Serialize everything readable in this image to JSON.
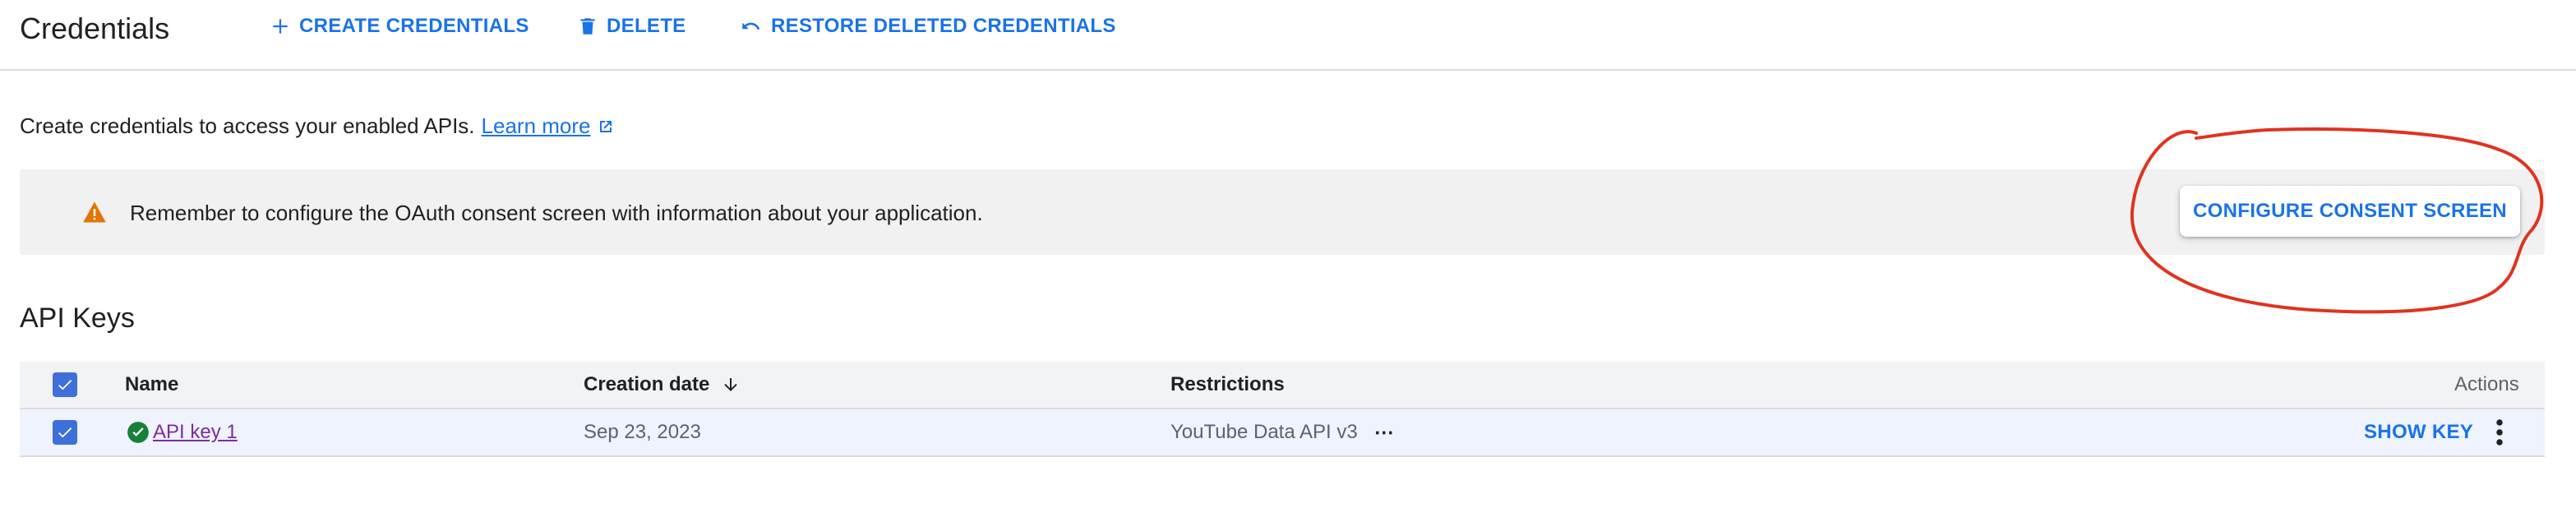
{
  "header": {
    "title": "Credentials",
    "create_label": "CREATE CREDENTIALS",
    "delete_label": "DELETE",
    "restore_label": "RESTORE DELETED CREDENTIALS"
  },
  "intro": {
    "text": "Create credentials to access your enabled APIs.",
    "link_label": "Learn more"
  },
  "banner": {
    "message": "Remember to configure the OAuth consent screen with information about your application.",
    "button_label": "CONFIGURE CONSENT SCREEN"
  },
  "api_keys": {
    "title": "API Keys",
    "columns": {
      "name": "Name",
      "creation_date": "Creation date",
      "restrictions": "Restrictions",
      "actions": "Actions"
    },
    "rows": [
      {
        "name": "API key 1",
        "creation_date": "Sep 23, 2023",
        "restrictions": "YouTube Data API v3",
        "more": "⋯",
        "show_key_label": "SHOW KEY",
        "checked": true,
        "status": "check-circle-icon"
      }
    ],
    "select_all_checked": true
  },
  "colors": {
    "accent": "#1a73e8",
    "warning": "#e37400",
    "success": "#188038",
    "annotation": "#e0331f",
    "checkbox": "#3f6fd8"
  }
}
